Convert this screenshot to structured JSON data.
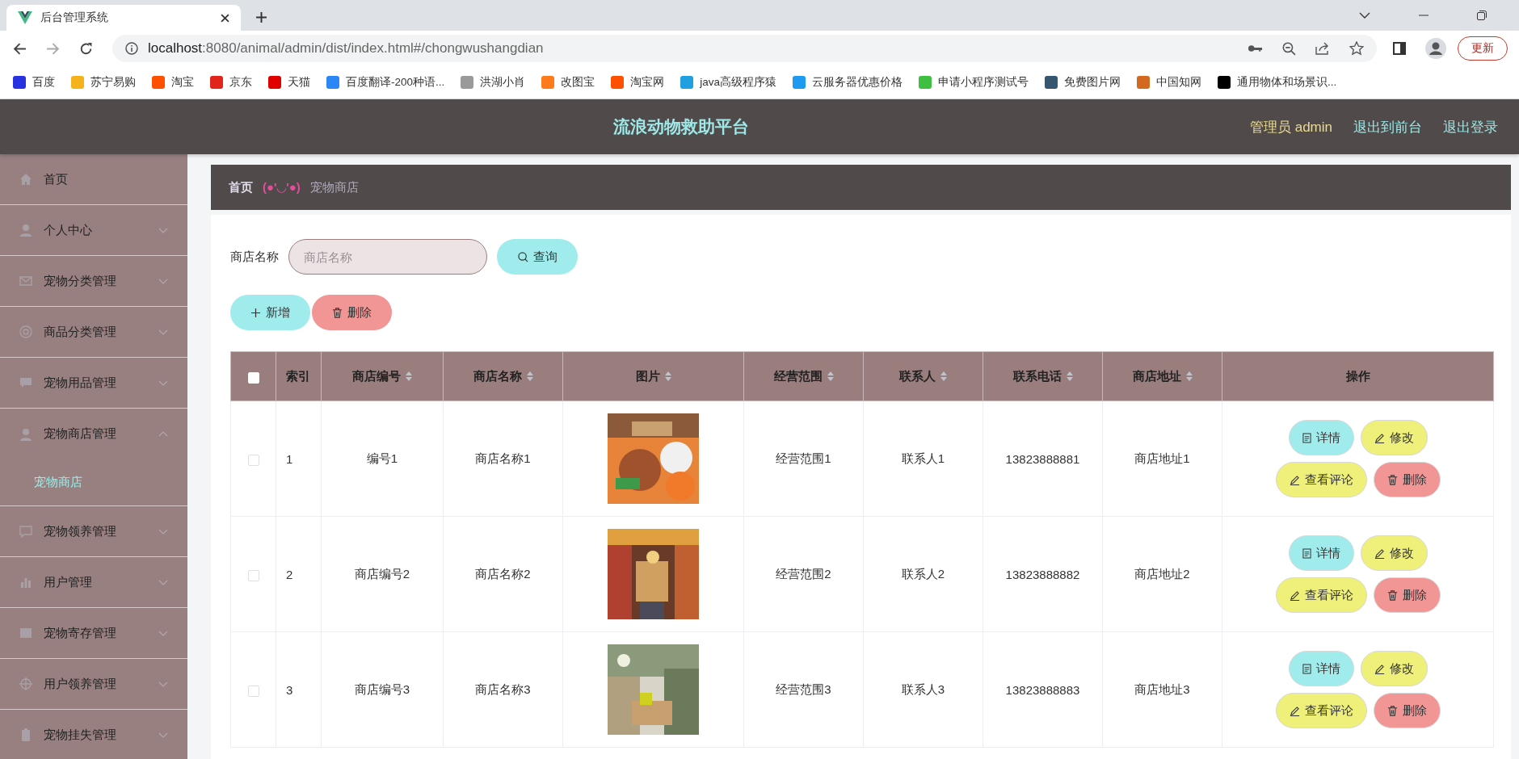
{
  "browser": {
    "tab_title": "后台管理系统",
    "url_host": "localhost",
    "url_rest": ":8080/animal/admin/dist/index.html#/chongwushangdian",
    "update_button": "更新",
    "bookmarks": [
      {
        "label": "百度",
        "color": "#2932e1"
      },
      {
        "label": "苏宁易购",
        "color": "#f5b21b"
      },
      {
        "label": "淘宝",
        "color": "#ff5000"
      },
      {
        "label": "京东",
        "color": "#e1251b"
      },
      {
        "label": "天猫",
        "color": "#e00000"
      },
      {
        "label": "百度翻译-200种语...",
        "color": "#2a87f5"
      },
      {
        "label": "洪湖小肖",
        "color": "#9a9a9a"
      },
      {
        "label": "改图宝",
        "color": "#ff7a1a"
      },
      {
        "label": "淘宝网",
        "color": "#ff5000"
      },
      {
        "label": "java高级程序猿",
        "color": "#20a0e0"
      },
      {
        "label": "云服务器优惠价格",
        "color": "#1e9bf0"
      },
      {
        "label": "申请小程序测试号",
        "color": "#3fbf3f"
      },
      {
        "label": "免费图片网",
        "color": "#35566e"
      },
      {
        "label": "中国知网",
        "color": "#d2691e"
      },
      {
        "label": "通用物体和场景识...",
        "color": "#000000"
      }
    ]
  },
  "header": {
    "title": "流浪动物救助平台",
    "user": "管理员 admin",
    "links": [
      "退出到前台",
      "退出登录"
    ]
  },
  "sidebar": {
    "items": [
      {
        "label": "首页"
      },
      {
        "label": "个人中心",
        "expanded": false
      },
      {
        "label": "宠物分类管理",
        "expanded": false
      },
      {
        "label": "商品分类管理",
        "expanded": false
      },
      {
        "label": "宠物用品管理",
        "expanded": false
      },
      {
        "label": "宠物商店管理",
        "expanded": true,
        "children": [
          {
            "label": "宠物商店",
            "selected": true
          }
        ]
      },
      {
        "label": "宠物领养管理",
        "expanded": false
      },
      {
        "label": "用户管理",
        "expanded": false
      },
      {
        "label": "宠物寄存管理",
        "expanded": false
      },
      {
        "label": "用户领养管理",
        "expanded": false
      },
      {
        "label": "宠物挂失管理",
        "expanded": false
      }
    ]
  },
  "breadcrumb": {
    "home": "首页",
    "separator": "(●'◡'●)",
    "current": "宠物商店"
  },
  "search": {
    "label": "商店名称",
    "placeholder": "商店名称",
    "button": "查询"
  },
  "actions": [
    {
      "label": "新增",
      "kind": "add"
    },
    {
      "label": "删除",
      "kind": "delete"
    }
  ],
  "table": {
    "select_all": {
      "checked": false
    },
    "columns": [
      {
        "label": "索引",
        "sortable": false
      },
      {
        "label": "商店编号",
        "sortable": true
      },
      {
        "label": "商店名称",
        "sortable": true
      },
      {
        "label": "图片",
        "sortable": true
      },
      {
        "label": "经营范围",
        "sortable": true
      },
      {
        "label": "联系人",
        "sortable": true
      },
      {
        "label": "联系电话",
        "sortable": true
      },
      {
        "label": "商店地址",
        "sortable": true
      },
      {
        "label": "操作",
        "sortable": false
      }
    ],
    "rows": [
      {
        "checked": false,
        "index": "1",
        "code": "编号1",
        "name": "商店名称1",
        "scope": "经营范围1",
        "contact": "联系人1",
        "phone": "13823888881",
        "address": "商店地址1",
        "actions": [
          {
            "label": "详情",
            "kind": "detail"
          },
          {
            "label": "修改",
            "kind": "edit"
          },
          {
            "label": "查看评论",
            "kind": "comment"
          },
          {
            "label": "删除",
            "kind": "delete"
          }
        ]
      },
      {
        "checked": false,
        "index": "2",
        "code": "商店编号2",
        "name": "商店名称2",
        "scope": "经营范围2",
        "contact": "联系人2",
        "phone": "13823888882",
        "address": "商店地址2",
        "actions": [
          {
            "label": "详情",
            "kind": "detail"
          },
          {
            "label": "修改",
            "kind": "edit"
          },
          {
            "label": "查看评论",
            "kind": "comment"
          },
          {
            "label": "删除",
            "kind": "delete"
          }
        ]
      },
      {
        "checked": false,
        "index": "3",
        "code": "商店编号3",
        "name": "商店名称3",
        "scope": "经营范围3",
        "contact": "联系人3",
        "phone": "13823888883",
        "address": "商店地址3",
        "actions": [
          {
            "label": "详情",
            "kind": "detail"
          },
          {
            "label": "修改",
            "kind": "edit"
          },
          {
            "label": "查看评论",
            "kind": "comment"
          },
          {
            "label": "删除",
            "kind": "delete"
          }
        ]
      }
    ]
  }
}
